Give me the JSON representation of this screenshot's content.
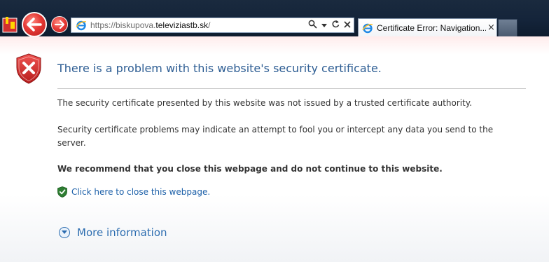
{
  "browser": {
    "address_bar": {
      "url_prefix": "https://biskupova.",
      "url_domain": "televiziastb.sk",
      "url_suffix": "/",
      "search_icon": "search-icon",
      "dropdown_icon": "chevron-down-icon",
      "refresh_icon": "refresh-icon",
      "stop_icon": "close-icon"
    },
    "tab": {
      "label": "Certificate Error: Navigation...",
      "close_glyph": "×"
    },
    "colors": {
      "chrome_bg": "#14243a",
      "back_button": "#e53935"
    }
  },
  "page": {
    "title": "There is a problem with this website's security certificate.",
    "paragraph1": "The security certificate presented by this website was not issued by a trusted certificate authority.",
    "paragraph2": "Security certificate problems may indicate an attempt to fool you or intercept any data you send to the server.",
    "recommendation": "We recommend that you close this webpage and do not continue to this website.",
    "close_link": "Click here to close this webpage.",
    "more_info": "More information",
    "colors": {
      "title": "#2d5d93",
      "link": "#1b5fa8",
      "error_shield": "#c62828",
      "ok_shield": "#2e7d32"
    }
  }
}
